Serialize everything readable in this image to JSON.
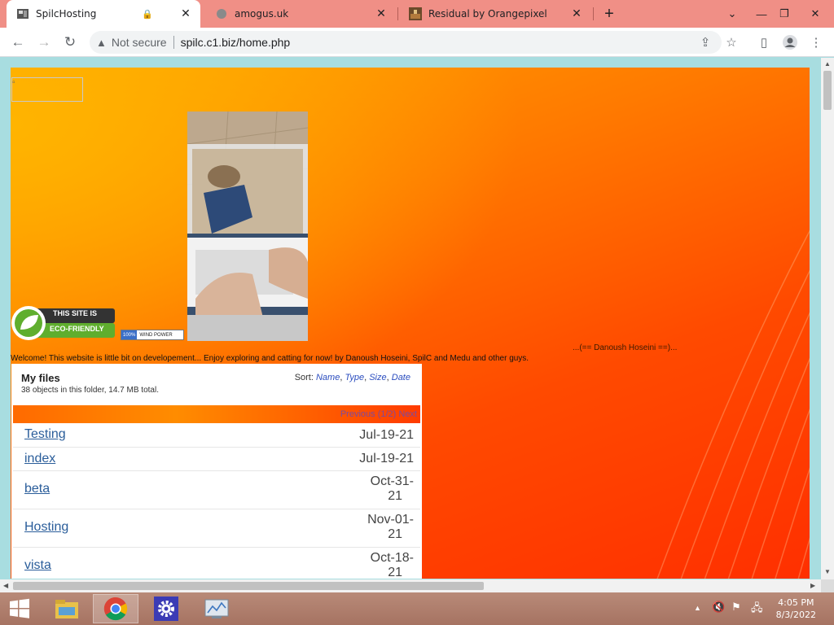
{
  "browser": {
    "tabs": [
      {
        "title": "SpilcHosting",
        "active": true,
        "icon": "site-favicon"
      },
      {
        "title": "amogus.uk",
        "active": false,
        "icon": "globe-favicon"
      },
      {
        "title": "Residual by Orangepixel",
        "active": false,
        "icon": "game-favicon"
      }
    ],
    "security_label": "Not secure",
    "url": "spilc.c1.biz/home.php"
  },
  "site": {
    "eco_badge_line1": "THIS SITE IS",
    "eco_badge_line2": "ECO-FRIENDLY",
    "wind_badge_pct": "100%",
    "wind_badge_label": "WIND POWER",
    "credit": "...(== Danoush Hoseini ==)...",
    "welcome": "Welcome! This website is little bit on developement... Enjoy exploring and catting for now! by Danoush Hoseini, SpilC and Medu and other guys."
  },
  "files": {
    "title": "My files",
    "summary": "38 objects in this folder, 14.7 MB total.",
    "sort_label": "Sort:",
    "sort_options": [
      "Name",
      "Type",
      "Size",
      "Date"
    ],
    "pager_prev": "Previous",
    "pager_page": "(1/2)",
    "pager_next": "Next",
    "rows": [
      {
        "name": "Testing",
        "date_line1": "Jul-19-21",
        "date_line2": ""
      },
      {
        "name": "index",
        "date_line1": "Jul-19-21",
        "date_line2": ""
      },
      {
        "name": "beta",
        "date_line1": "Oct-31-",
        "date_line2": "21"
      },
      {
        "name": "Hosting",
        "date_line1": "Nov-01-",
        "date_line2": "21"
      },
      {
        "name": "vista",
        "date_line1": "Oct-18-",
        "date_line2": "21"
      }
    ]
  },
  "taskbar": {
    "time": "4:05 PM",
    "date": "8/3/2022"
  },
  "colors": {
    "tabstrip": "#f08f86",
    "accent_orange": "#ff7a00",
    "link_blue": "#2a5d9a"
  }
}
